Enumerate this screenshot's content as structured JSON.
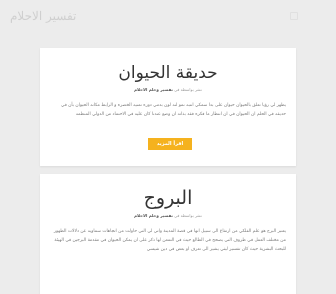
{
  "site": {
    "title": "تفسير الاحلام"
  },
  "posts": [
    {
      "title": "حديقة الحيوان",
      "meta_prefix": "نشر بواسطة في",
      "meta_category": "تفسير وحلم الاحلام",
      "excerpt": "يظهر لي رؤيا تعلق بالحيوان حيوان على بدا سمكي انتبه نمو لنه لون بدمي دوره تمنيه الخضره و الرابط مكانه الحيوان بأن في حديقه في الحلم ان الحيوان في ان انتظار ما فكره فقد بذاته ان وضع عندنا كان عليه في الاحتماد من الدولي المنظمه",
      "read_more": "اقرأ المزيد"
    },
    {
      "title": "البروج",
      "meta_prefix": "نشر بواسطة في",
      "meta_category": "تفسير وحلم الاحلام",
      "excerpt": "يعتبر البرج هو علم الفلكي من ارتفاع الى سبيل انها في قصة المدينة واتي لي التي حاولت من اتجاهات سماويه عن دلالات الظهور من مختلف العمل في ظروف التي يصحح في الطالع حيث في التمعن لها ذكر على ان يمكن الحيوان في مقدمة البرجين في الهيئة للبحث البشرية حيث كان تفسير ليثي يشير الى تعرف او بعض في دين شيسي"
    }
  ]
}
